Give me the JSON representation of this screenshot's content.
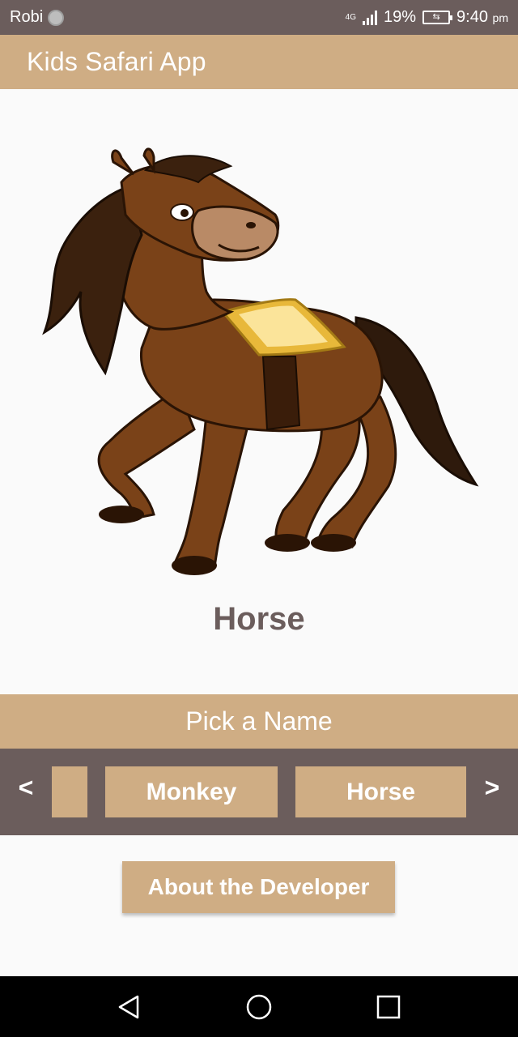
{
  "status_bar": {
    "carrier": "Robi",
    "network": "4G",
    "battery_percent": "19%",
    "time": "9:40",
    "time_suffix": "pm"
  },
  "app_bar": {
    "title": "Kids Safari App"
  },
  "animal": {
    "image_icon": "horse-illustration",
    "name": "Horse"
  },
  "picker": {
    "title": "Pick a Name",
    "prev_label": "<",
    "next_label": ">",
    "options": [
      "",
      "Monkey",
      "Horse"
    ]
  },
  "about_button": {
    "label": "About the Developer"
  },
  "nav_bar": {
    "back_icon": "back-triangle-icon",
    "home_icon": "home-circle-icon",
    "recents_icon": "recents-square-icon"
  },
  "colors": {
    "accent": "#cfad84",
    "dark": "#6b5d5c",
    "background": "#fafafa"
  }
}
